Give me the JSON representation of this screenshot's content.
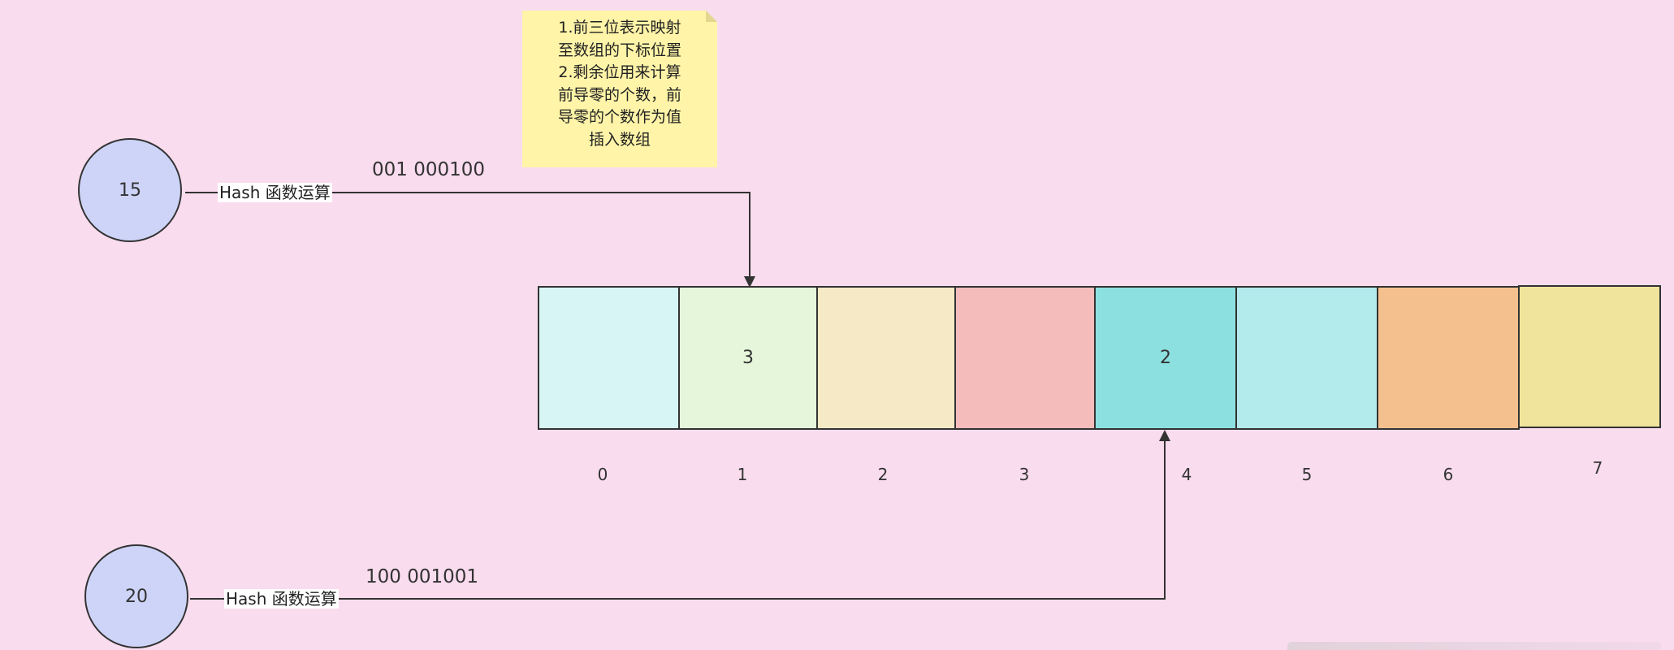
{
  "note": {
    "lines": [
      "1.前三位表示映射",
      "至数组的下标位置",
      "2.剩余位用来计算",
      "前导零的个数，前",
      "导零的个数作为值",
      "插入数组"
    ]
  },
  "nodes": [
    {
      "value": "15",
      "edge_label": "Hash 函数运算",
      "code": "001 000100",
      "target_index": 1
    },
    {
      "value": "20",
      "edge_label": "Hash 函数运算",
      "code": "100 001001",
      "target_index": 4
    }
  ],
  "array": {
    "cells": [
      {
        "index": "0",
        "value": "",
        "color": "#d8f5f6"
      },
      {
        "index": "1",
        "value": "3",
        "color": "#e6f6da"
      },
      {
        "index": "2",
        "value": "",
        "color": "#f6eac6"
      },
      {
        "index": "3",
        "value": "",
        "color": "#f5bcbc"
      },
      {
        "index": "4",
        "value": "2",
        "color": "#8de0e0"
      },
      {
        "index": "5",
        "value": "",
        "color": "#b3eaeb"
      },
      {
        "index": "6",
        "value": "",
        "color": "#f4c08e"
      },
      {
        "index": "7",
        "value": "",
        "color": "#f0e49c"
      }
    ]
  },
  "colors": {
    "background": "#f9dcee",
    "node_fill": "#ced4f8",
    "note_fill": "#fff4a8",
    "stroke": "#333333"
  }
}
